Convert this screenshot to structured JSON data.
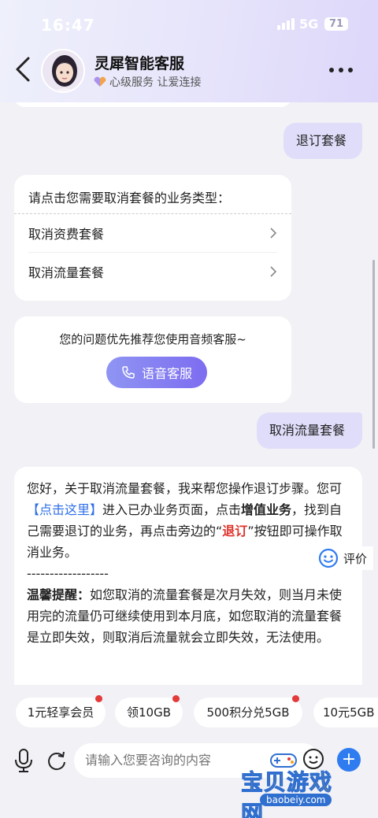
{
  "status_bar": {
    "time": "16:47",
    "network": "5G",
    "battery": "71"
  },
  "header": {
    "title": "灵犀智能客服",
    "subtitle": "心级服务 让爱连接"
  },
  "messages": {
    "user_1": "退订套餐",
    "menu_prompt": "请点击您需要取消套餐的业务类型：",
    "menu_items": [
      "取消资费套餐",
      "取消流量套餐"
    ],
    "voice_prompt": "您的问题优先推荐您使用音频客服~",
    "voice_button": "语音客服",
    "user_2": "取消流量套餐",
    "answer": {
      "p1_a": "您好，关于取消流量套餐，我来帮您操作退订步骤。您可",
      "p1_link": "【点击这里】",
      "p1_b": "进入已办业务页面，点击",
      "p1_bold": "增值业务",
      "p1_c": "，找到自己需要退订的业务，再点击旁边的“",
      "p1_red": "退订",
      "p1_d": "”按钮即可操作取消业务。",
      "divider": "------------------",
      "tip_label": "温馨提醒：",
      "tip_text": "如您取消的流量套餐是次月失效，则当月未使用完的流量仍可继续使用到本月底，如您取消的流量套餐是立即失效，则取消后流量就会立即失效，无法使用。"
    },
    "rate_label": "评价"
  },
  "quick_chips": [
    "1元轻享会员",
    "领10GB",
    "500积分兑5GB",
    "10元5GB"
  ],
  "input": {
    "placeholder": "请输入您要咨询的内容"
  },
  "watermark": {
    "main": "宝贝游戏网",
    "sub": "baobeiy.com"
  },
  "colors": {
    "accent": "#2f7bf0",
    "link": "#2f6fe8",
    "warn": "#e0322b",
    "user_bubble": "#e0ddfa"
  }
}
